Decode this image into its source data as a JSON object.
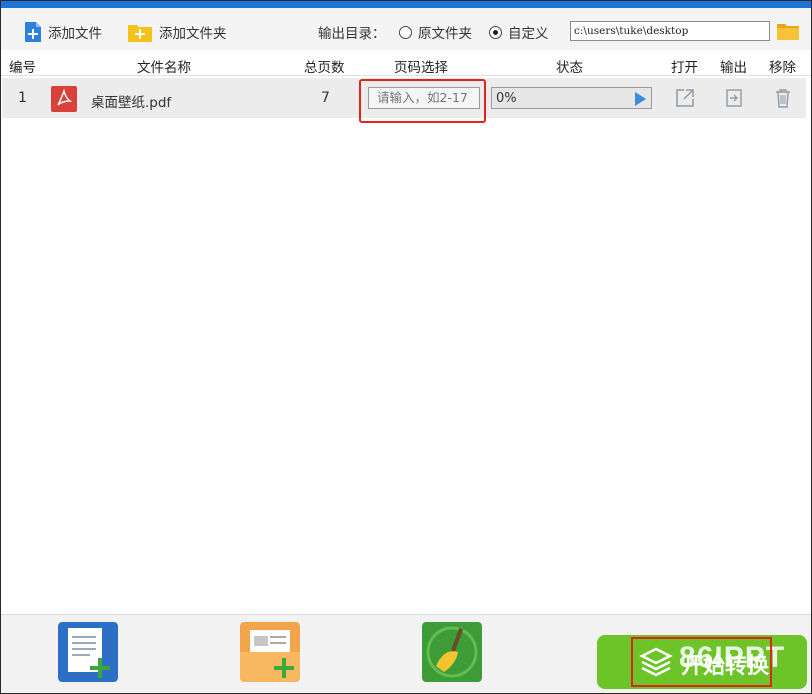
{
  "toolbar": {
    "add_file_label": "添加文件",
    "add_folder_label": "添加文件夹",
    "output_dir_label": "输出目录：",
    "radio_original": "原文件夹",
    "radio_custom": "自定义",
    "output_path": "c:\\users\\tuke\\desktop",
    "selected_output": "custom"
  },
  "table": {
    "columns": [
      "编号",
      "文件名称",
      "总页数",
      "页码选择",
      "状态",
      "打开",
      "输出",
      "移除"
    ],
    "rows": [
      {
        "index": "1",
        "filename": "桌面壁纸.pdf",
        "pages": "7",
        "range_placeholder": "请输入，如2-17",
        "progress_text": "0%",
        "progress_value": 0
      }
    ]
  },
  "bottom": {
    "start_label": "开始转换",
    "watermark": "86IPPT"
  },
  "colors": {
    "accent": "#1e73d8",
    "progress": "#3b8ddb",
    "pdf_red": "#d9423a",
    "start_green": "#6cc428",
    "highlight": "#e0251e"
  }
}
